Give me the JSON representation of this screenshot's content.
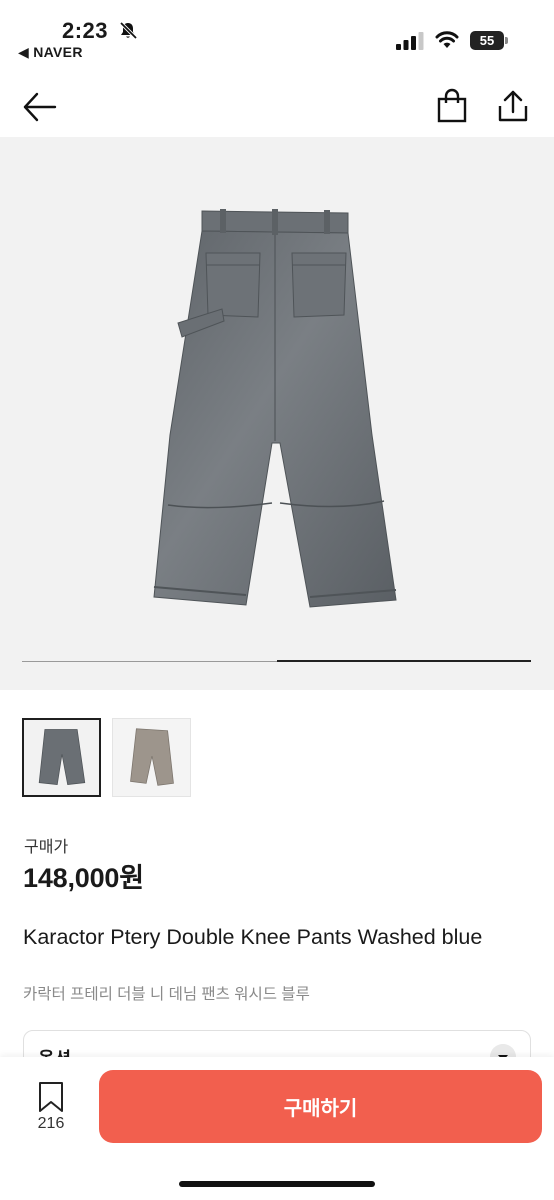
{
  "status_bar": {
    "time": "2:23",
    "back_app": "◀ NAVER",
    "battery": "55",
    "battery_level_percent": 55
  },
  "nav": {
    "back_icon": "arrow-left-icon",
    "bag_icon": "shopping-bag-icon",
    "share_icon": "share-icon"
  },
  "gallery": {
    "current_image": 2,
    "image_count": 2,
    "progress_fraction": 0.5,
    "thumbnails": [
      {
        "name": "washed-blue",
        "selected": true
      },
      {
        "name": "washed-grey",
        "selected": false
      }
    ]
  },
  "product": {
    "price_label": "구매가",
    "price": "148,000원",
    "title": "Karactor Ptery Double Knee Pants Washed blue",
    "subtitle": "카락터 프테리 더블 니 데님 팬츠 워시드 블루"
  },
  "option": {
    "label": "옵션"
  },
  "bottom": {
    "wish_count": "216",
    "buy_label": "구매하기"
  },
  "colors": {
    "accent": "#f25f4e",
    "hero_bg": "#f2f2f2"
  }
}
